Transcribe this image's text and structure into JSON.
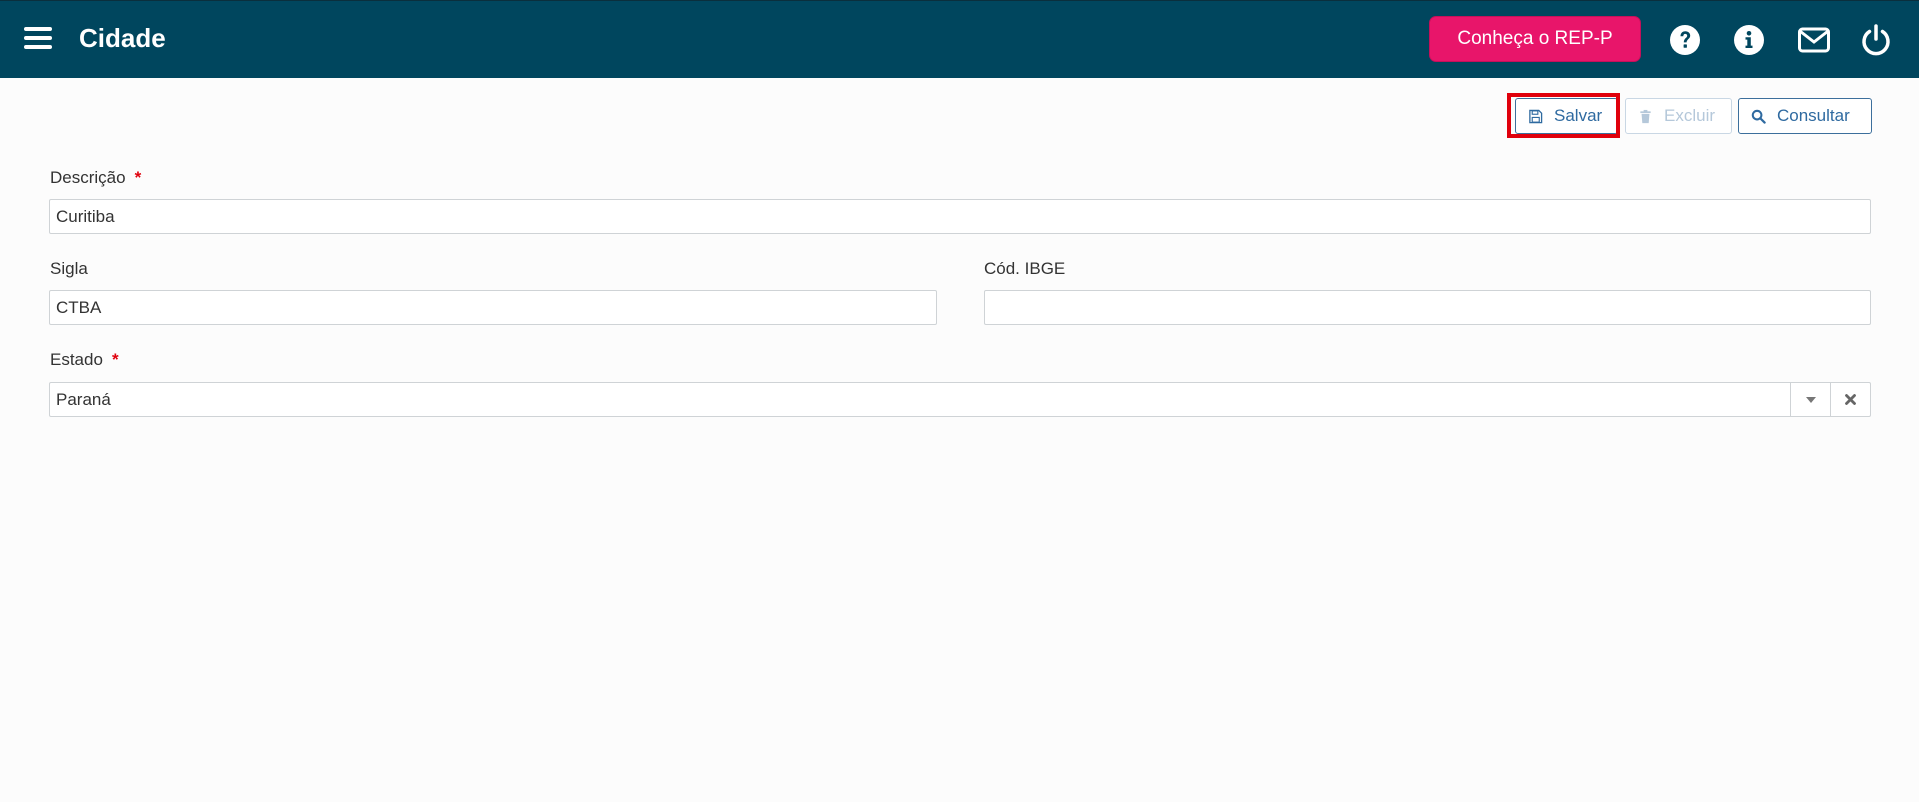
{
  "header": {
    "title": "Cidade",
    "promo_button": "Conheça o REP-P",
    "bg_color": "#00465e",
    "promo_color": "#e8156a"
  },
  "toolbar": {
    "save_label": "Salvar",
    "delete_label": "Excluir",
    "query_label": "Consultar"
  },
  "form": {
    "descricao": {
      "label": "Descrição",
      "required_mark": "*",
      "value": "Curitiba"
    },
    "sigla": {
      "label": "Sigla",
      "value": "CTBA"
    },
    "cod_ibge": {
      "label": "Cód. IBGE",
      "value": ""
    },
    "estado": {
      "label": "Estado",
      "required_mark": "*",
      "value": "Paraná"
    }
  },
  "icons": {
    "menu": "hamburger-menu-icon",
    "help": "question-circle-icon",
    "info": "info-circle-icon",
    "mail": "envelope-icon",
    "logout": "power-icon",
    "save": "floppy-disk-icon",
    "delete": "trash-icon",
    "query": "search-icon",
    "dropdown": "caret-down-icon",
    "clear": "times-icon"
  }
}
